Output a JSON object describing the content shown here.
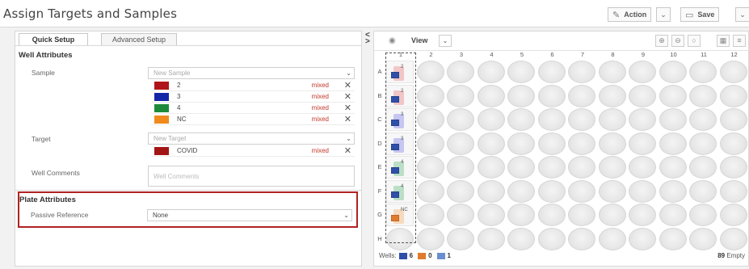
{
  "window": {
    "title": "Assign Targets and Samples"
  },
  "toolbar": {
    "action_label": "Action",
    "save_label": "Save"
  },
  "tabs": [
    {
      "label": "Quick Setup",
      "active": true
    },
    {
      "label": "Advanced Setup",
      "active": false
    }
  ],
  "well_attributes": {
    "title": "Well Attributes",
    "sample_label": "Sample",
    "sample_placeholder": "New Sample",
    "samples": [
      {
        "name": "2",
        "color": "#b0141b",
        "status": "mixed"
      },
      {
        "name": "3",
        "color": "#1426a8",
        "status": "mixed"
      },
      {
        "name": "4",
        "color": "#1d8a3a",
        "status": "mixed"
      },
      {
        "name": "NC",
        "color": "#f08a1c",
        "status": "mixed"
      }
    ],
    "target_label": "Target",
    "target_placeholder": "New Target",
    "targets": [
      {
        "name": "COVID",
        "color": "#a31515",
        "status": "mixed"
      }
    ],
    "comments_label": "Well Comments",
    "comments_placeholder": "Well Comments"
  },
  "plate_attributes": {
    "title": "Plate Attributes",
    "passive_reference_label": "Passive Reference",
    "passive_reference_value": "None"
  },
  "plate": {
    "view_label": "View",
    "columns": [
      "1",
      "2",
      "3",
      "4",
      "5",
      "6",
      "7",
      "8",
      "9",
      "10",
      "11",
      "12"
    ],
    "rows": [
      "A",
      "B",
      "C",
      "D",
      "E",
      "F",
      "G",
      "H"
    ],
    "filled_wells": [
      {
        "row": "A",
        "sample": "2",
        "color": "#e88a8a"
      },
      {
        "row": "B",
        "sample": "2",
        "color": "#e88a8a"
      },
      {
        "row": "C",
        "sample": "3",
        "color": "#8a8ae8"
      },
      {
        "row": "D",
        "sample": "3",
        "color": "#8a8ae8"
      },
      {
        "row": "E",
        "sample": "4",
        "color": "#6fc08a"
      },
      {
        "row": "F",
        "sample": "4",
        "color": "#6fc08a"
      },
      {
        "row": "G",
        "sample": "NC",
        "color": "#f3b57a"
      }
    ],
    "well_chip_color": "#2f4fa8"
  },
  "footer": {
    "wells_label": "Wells:",
    "unknown_count": "6",
    "ntc_count": "0",
    "standard_count": "1",
    "empty_count": "89",
    "empty_label": "Empty"
  },
  "colors": {
    "highlight_border": "#b22222"
  }
}
